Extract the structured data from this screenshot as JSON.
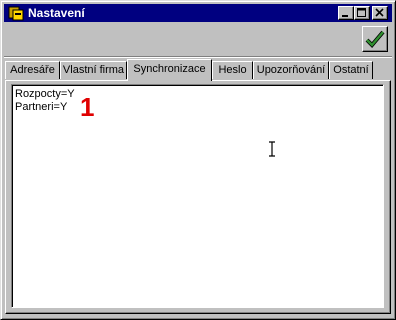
{
  "window": {
    "title": "Nastavení",
    "controls": [
      "minimize-icon",
      "maximize-icon",
      "close-icon"
    ]
  },
  "toolbar": {
    "ok_icon": "checkmark-icon",
    "ok_color": "#2f8f2f"
  },
  "tabs": [
    {
      "label": "Adresáře"
    },
    {
      "label": "Vlastní firma"
    },
    {
      "label": "Synchronizace",
      "active": true
    },
    {
      "label": "Heslo"
    },
    {
      "label": "Upozorňování"
    },
    {
      "label": "Ostatní"
    }
  ],
  "editor": {
    "lines": [
      "Rozpocty=Y",
      "Partneri=Y"
    ],
    "marker": "1",
    "marker_color": "#e00000",
    "cursor_icon": "ibeam-cursor-icon"
  }
}
